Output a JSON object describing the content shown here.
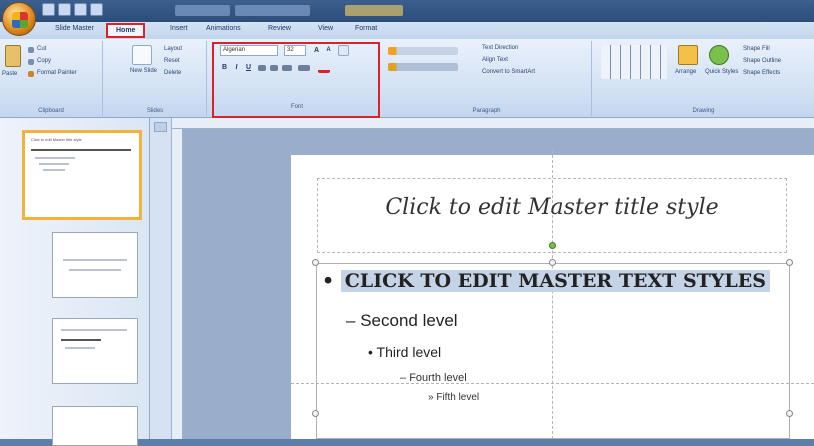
{
  "tabs": {
    "slide_master": "Slide Master",
    "home": "Home",
    "insert": "Insert",
    "animations": "Animations",
    "review": "Review",
    "view": "View",
    "format": "Format"
  },
  "clipboard": {
    "paste": "Paste",
    "cut": "Cut",
    "copy": "Copy",
    "format_painter": "Format Painter",
    "label": "Clipboard"
  },
  "slides_group": {
    "new_slide": "New Slide",
    "layout": "Layout",
    "reset": "Reset",
    "delete": "Delete",
    "label": "Slides"
  },
  "font": {
    "font_name": "Algerian",
    "font_size": "32",
    "grow": "A",
    "shrink": "A",
    "bold": "B",
    "italic": "I",
    "underline": "U",
    "label": "Font"
  },
  "paragraph": {
    "text_direction": "Text Direction",
    "align_text": "Align Text",
    "convert_smartart": "Convert to SmartArt",
    "label": "Paragraph"
  },
  "drawing": {
    "arrange": "Arrange",
    "quick_styles": "Quick Styles",
    "shape_fill": "Shape Fill",
    "shape_outline": "Shape Outline",
    "shape_effects": "Shape Effects",
    "label": "Drawing"
  },
  "slide": {
    "title": "Click to edit Master title style",
    "level1": "CLICK TO EDIT MASTER TEXT STYLES",
    "level2": "Second level",
    "level3": "Third level",
    "level4": "Fourth level",
    "level5": "Fifth level",
    "bullet1": "•",
    "bullet2": "–",
    "bullet3": "•",
    "bullet4": "–",
    "bullet5": "»"
  },
  "thumbnails": {
    "first_title": "Click to edit Master title style"
  },
  "colors": {
    "highlight": "#d8232a",
    "selection": "#f3b23a"
  }
}
